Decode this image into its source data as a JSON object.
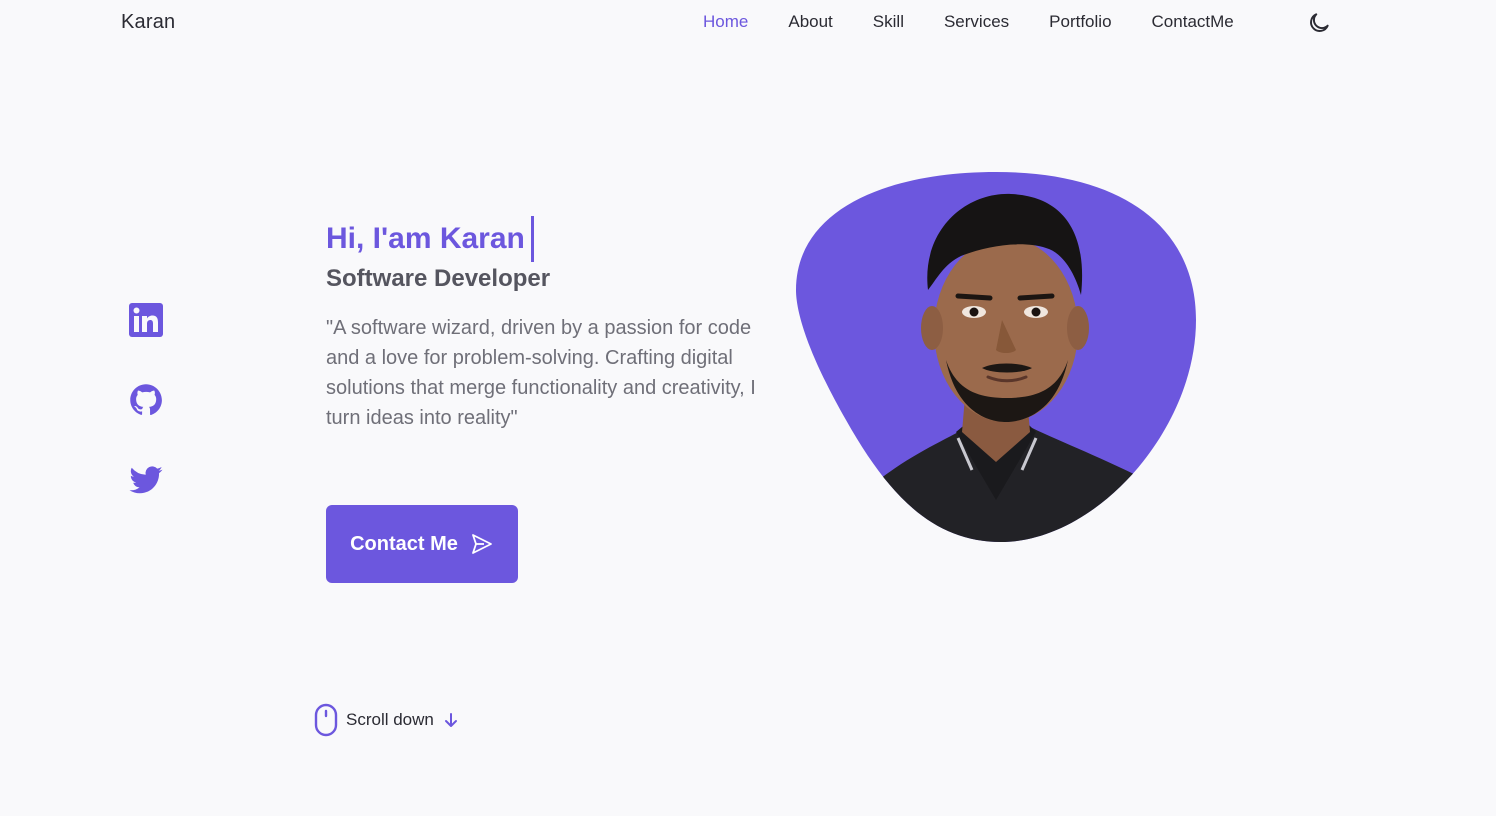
{
  "header": {
    "logo": "Karan",
    "nav": [
      "Home",
      "About",
      "Skill",
      "Services",
      "Portfolio",
      "ContactMe"
    ],
    "active_nav": "Home",
    "theme_icon": "moon-icon"
  },
  "social": [
    {
      "name": "linkedin-icon"
    },
    {
      "name": "github-icon"
    },
    {
      "name": "twitter-icon"
    }
  ],
  "hero": {
    "title": "Hi, I'am Karan",
    "subtitle": "Software Developer",
    "description": "\"A software wizard, driven by a passion for code and a love for problem-solving. Crafting digital solutions that merge functionality and creativity, I turn ideas into reality\"",
    "cta_label": "Contact Me",
    "cta_icon": "send-icon"
  },
  "scroll": {
    "label": "Scroll down",
    "icon": "mouse-icon",
    "arrow_icon": "arrow-down-icon"
  },
  "colors": {
    "accent": "#6c57de",
    "background": "#f9f9fb",
    "text": "#2b2b33",
    "muted": "#6f6f78"
  }
}
